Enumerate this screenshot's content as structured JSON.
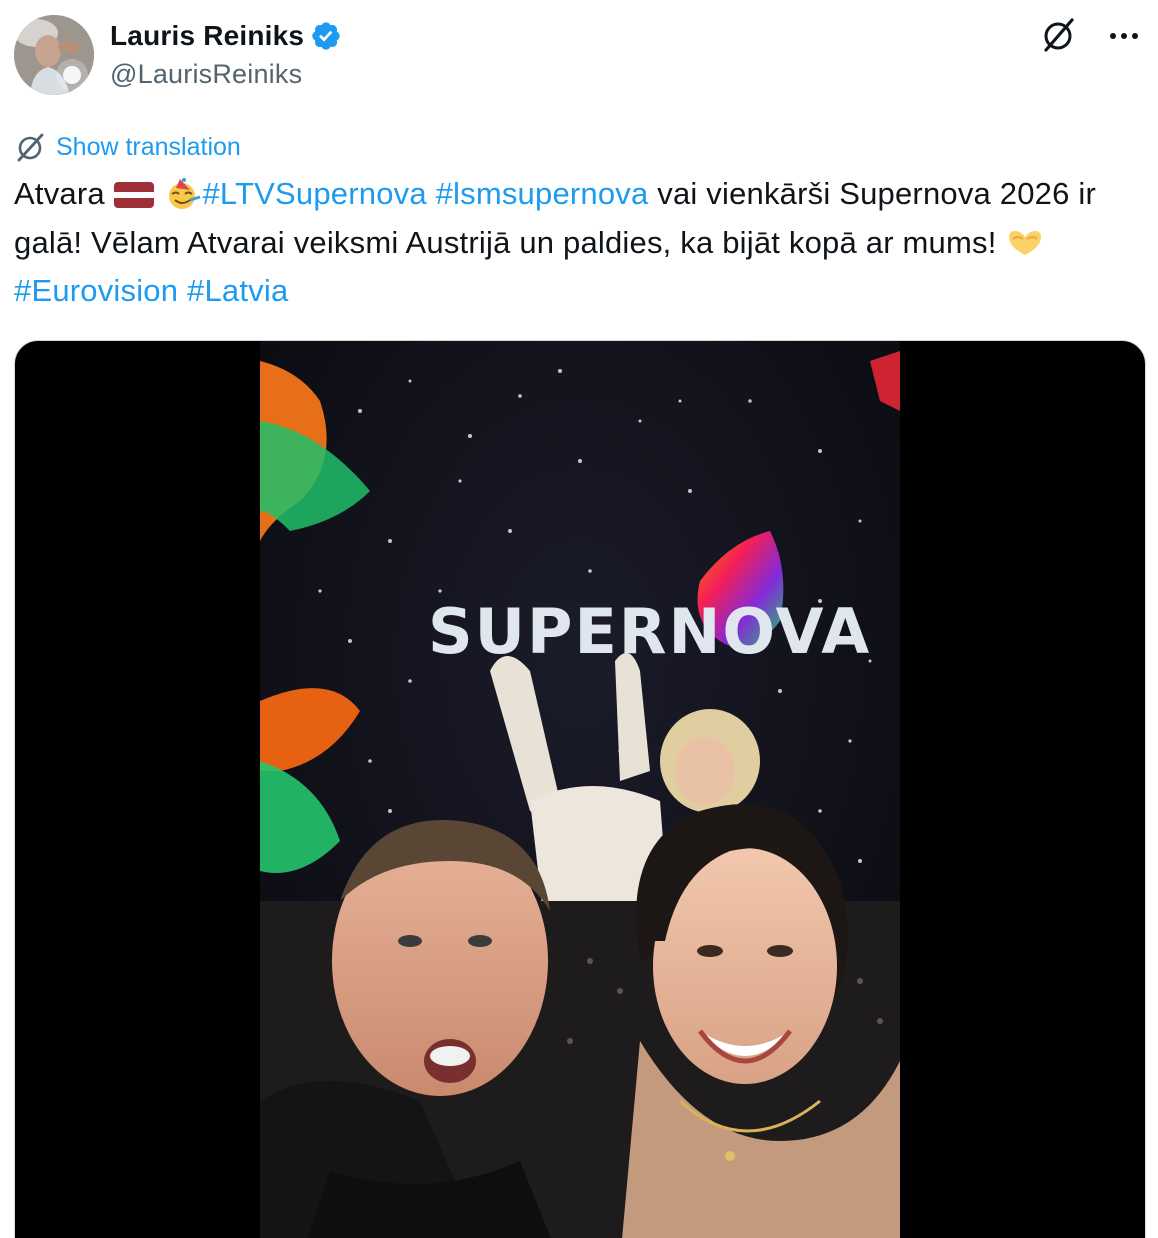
{
  "author": {
    "display_name": "Lauris Reiniks",
    "handle": "@LaurisReiniks",
    "verified": true
  },
  "actions": {
    "grok_icon": "grok-icon",
    "more_icon": "more-icon"
  },
  "translation": {
    "label": "Show translation"
  },
  "post": {
    "text_1": "Atvara ",
    "hashtag_1": "#LTVSupernova",
    "hashtag_2": "#lsmsupernova",
    "text_2": " vai vienkārši Supernova 2026 ir galā! Vēlam Atvarai veiksmi Austrijā un paldies, ka bijāt kopā ar mums! ",
    "hashtag_3": "#Eurovision",
    "hashtag_4": "#Latvia",
    "emojis": [
      "latvia-flag-icon",
      "party-face-icon",
      "heart-hands-icon"
    ]
  },
  "media": {
    "video_overlay_text": "SUPERNOVA"
  },
  "colors": {
    "accent": "#1d9bf0",
    "text": "#0f1419",
    "secondary": "#536471",
    "flag_red": "#9e3039"
  }
}
